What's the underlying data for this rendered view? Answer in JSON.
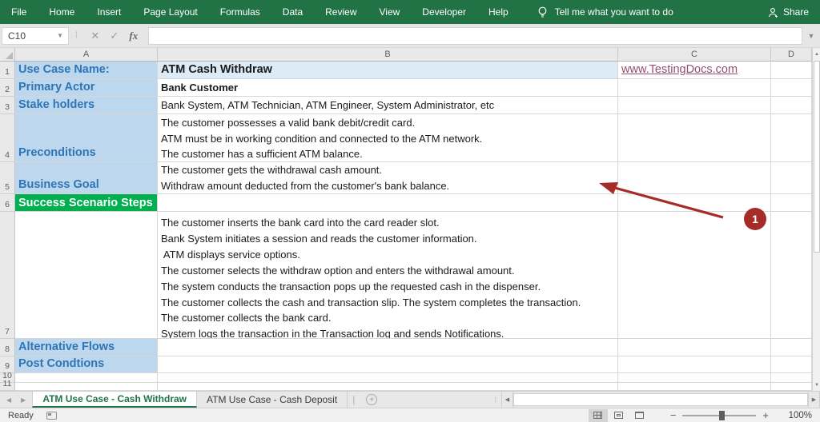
{
  "ribbon": {
    "menus": [
      "File",
      "Home",
      "Insert",
      "Page Layout",
      "Formulas",
      "Data",
      "Review",
      "View",
      "Developer",
      "Help"
    ],
    "tell_me": "Tell me what you want to do",
    "share_label": "Share"
  },
  "formula_bar": {
    "name_box": "C10",
    "formula_value": ""
  },
  "grid": {
    "column_headers": [
      "A",
      "B",
      "C",
      "D"
    ],
    "row_numbers": [
      "1",
      "2",
      "3",
      "4",
      "5",
      "6",
      "7",
      "8",
      "9",
      "10",
      "11"
    ]
  },
  "cells": {
    "a1": "Use Case Name:",
    "b1": "ATM Cash Withdraw",
    "c1": "www.TestingDocs.com",
    "a2": "Primary Actor",
    "b2": "Bank Customer",
    "a3": "Stake holders",
    "b3": "Bank System, ATM Technician, ATM Engineer, System Administrator, etc",
    "a4": "Preconditions",
    "b4_lines": [
      "The customer possesses a valid bank debit/credit card.",
      "ATM must be in working condition and connected to the ATM network.",
      "The customer has a sufficient ATM balance."
    ],
    "a5": "Business Goal",
    "b5_lines": [
      "The customer gets the withdrawal cash amount.",
      "Withdraw amount deducted from the customer's bank balance."
    ],
    "a6": "Success Scenario Steps",
    "b7_lines": [
      "The customer inserts the bank card into the card reader slot.",
      "Bank System initiates a session and reads the customer information.",
      " ATM displays service options.",
      "The customer selects the withdraw option and enters the withdrawal amount.",
      "The system conducts the transaction pops up the requested cash in the dispenser.",
      "The customer collects the cash and transaction slip. The system completes the transaction.",
      "The customer collects the bank card.",
      "System logs the transaction in the Transaction log and sends Notifications."
    ],
    "a8": "Alternative Flows",
    "a9": "Post Condtions"
  },
  "annotation": {
    "number": "1"
  },
  "sheet_tabs": {
    "active": "ATM Use Case - Cash Withdraw",
    "inactive": "ATM Use Case - Cash Deposit"
  },
  "status_bar": {
    "ready": "Ready",
    "zoom_level": "100%"
  },
  "colors": {
    "ribbon_green": "#217346",
    "label_text_blue": "#2E75B6",
    "fill_blue": "#BDD7EE",
    "fill_blue_light": "#DDEBF7",
    "fill_green": "#00B050",
    "link_maroon": "#954F72",
    "annotation_red": "#A62C2A"
  }
}
